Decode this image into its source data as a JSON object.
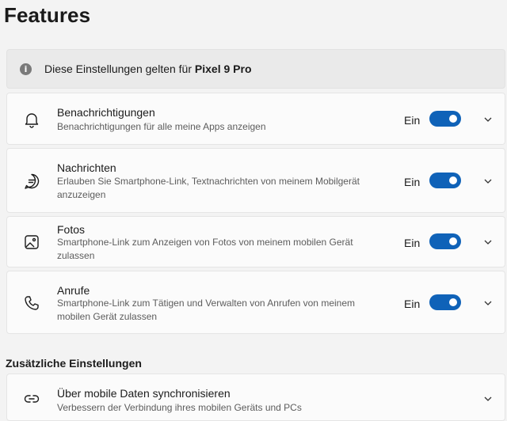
{
  "page": {
    "title": "Features"
  },
  "info_banner": {
    "text_prefix": "Diese Einstellungen gelten für ",
    "device_name": "Pixel 9 Pro",
    "icon": "info-icon"
  },
  "features": [
    {
      "title": "Benachrichtigungen",
      "description": "Benachrichtigungen für alle meine Apps anzeigen",
      "state_label": "Ein",
      "enabled": true,
      "icon": "bell-icon"
    },
    {
      "title": "Nachrichten",
      "description": "Erlauben Sie Smartphone-Link, Textnachrichten von meinem Mobilgerät anzuzeigen",
      "state_label": "Ein",
      "enabled": true,
      "icon": "message-icon"
    },
    {
      "title": "Fotos",
      "description": "Smartphone-Link zum Anzeigen von Fotos von meinem mobilen Gerät zulassen",
      "state_label": "Ein",
      "enabled": true,
      "icon": "photos-icon"
    },
    {
      "title": "Anrufe",
      "description": "Smartphone-Link zum Tätigen und Verwalten von Anrufen von meinem mobilen Gerät zulassen",
      "state_label": "Ein",
      "enabled": true,
      "icon": "phone-icon"
    }
  ],
  "additional": {
    "heading": "Zusätzliche Einstellungen",
    "items": [
      {
        "title": "Über mobile Daten synchronisieren",
        "description": "Verbessern der Verbindung ihres mobilen Geräts und PCs",
        "icon": "link-icon"
      }
    ]
  },
  "colors": {
    "accent": "#0f62b8",
    "background": "#f3f3f3",
    "card": "#fbfbfb"
  }
}
